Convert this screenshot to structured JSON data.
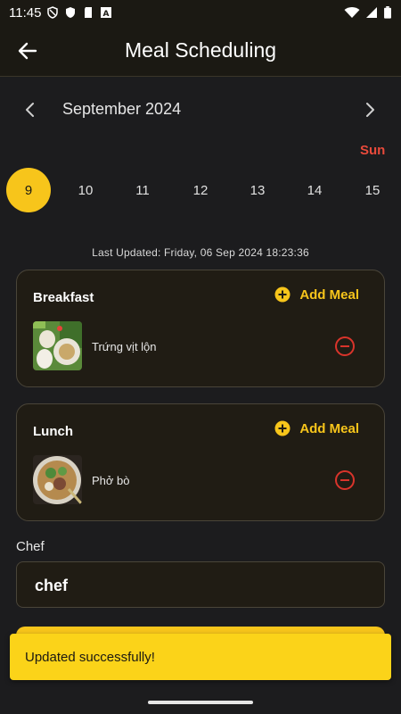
{
  "status_bar": {
    "time": "11:45",
    "left_icons": [
      "shield-alert-icon",
      "shield-icon",
      "sd-card-icon",
      "font-a-icon"
    ],
    "right_icons": [
      "wifi-icon",
      "signal-icon",
      "battery-icon"
    ]
  },
  "app_bar": {
    "title": "Meal Scheduling",
    "back_icon": "arrow-back-icon"
  },
  "calendar": {
    "month_label": "September 2024",
    "day_name": "Sun",
    "dates": [
      "9",
      "10",
      "11",
      "12",
      "13",
      "14",
      "15"
    ],
    "selected_date": "9"
  },
  "last_updated": "Last Updated: Friday, 06 Sep 2024 18:23:36",
  "meals": [
    {
      "title": "Breakfast",
      "add_label": "Add Meal",
      "item_name": "Trứng vịt lộn"
    },
    {
      "title": "Lunch",
      "add_label": "Add Meal",
      "item_name": "Phở bò"
    }
  ],
  "chef": {
    "label": "Chef",
    "value": "chef"
  },
  "snackbar": {
    "message": "Updated successfully!"
  },
  "colors": {
    "accent": "#f7c51b",
    "remove": "#d9342b",
    "sunday": "#e84a3b",
    "background": "#1c1c1e"
  }
}
